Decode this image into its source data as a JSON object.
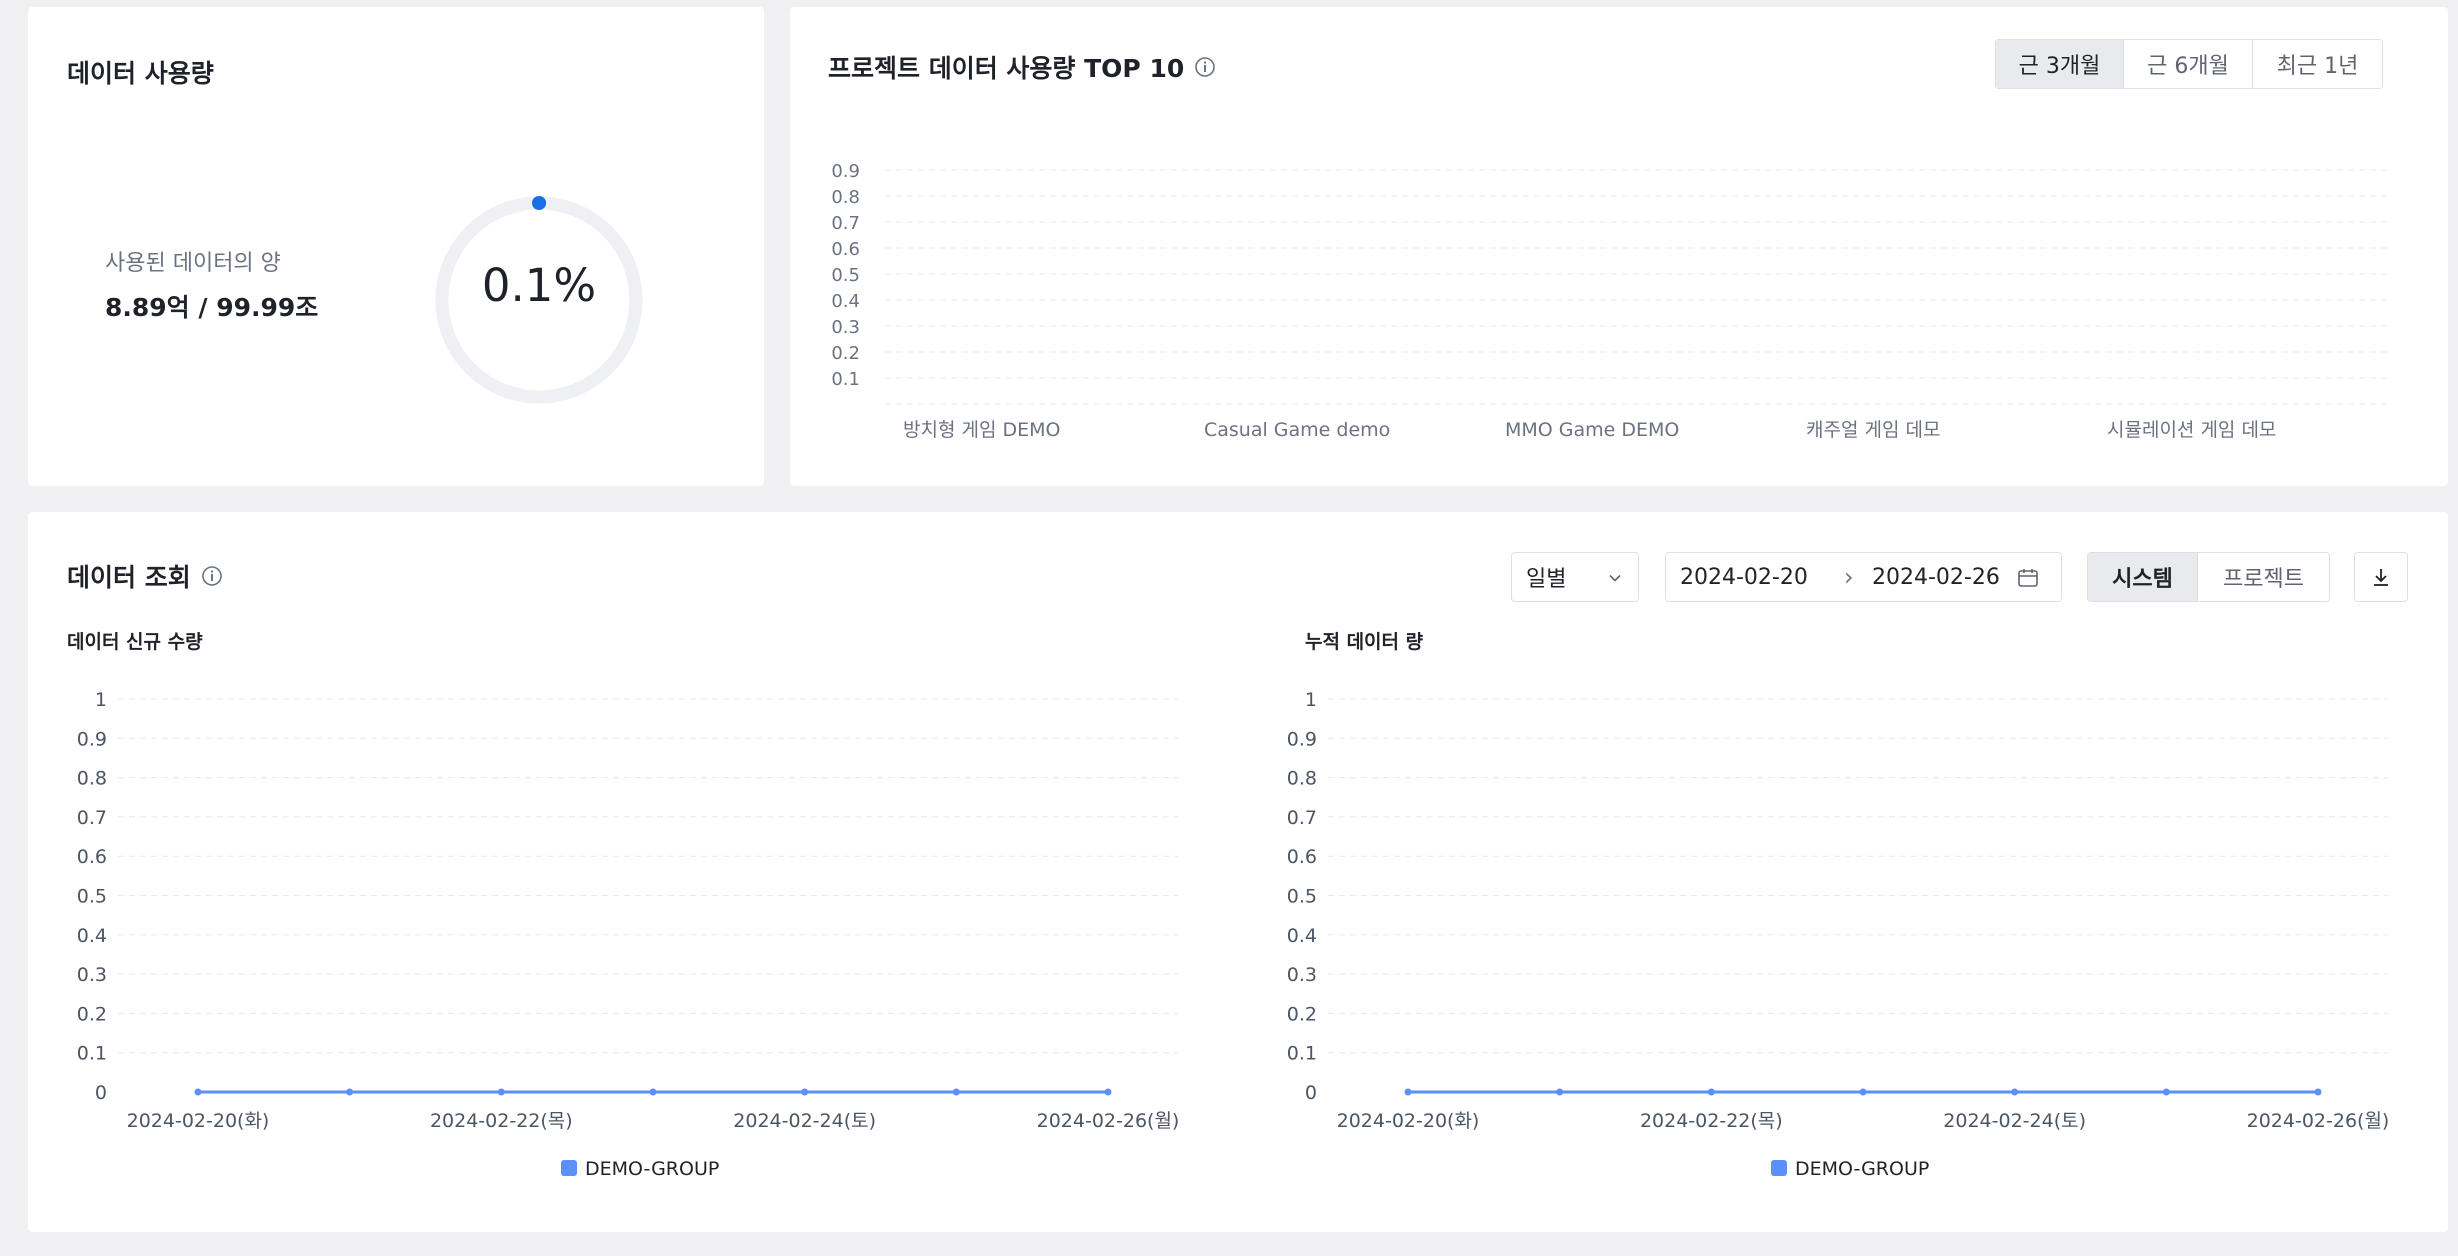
{
  "usage_card": {
    "title": "데이터 사용량",
    "used_label": "사용된 데이터의 양",
    "used_value": "8.89억 / 99.99조",
    "percent_text": "0.1%",
    "percent_value": 0.1,
    "accent_color": "#1a6fe8"
  },
  "top10_card": {
    "title": "프로젝트 데이터 사용량 TOP 10",
    "info_icon": "info-circle-icon",
    "ranges": [
      "근 3개월",
      "근 6개월",
      "최근 1년"
    ],
    "active_range": 0
  },
  "query_card": {
    "title": "데이터 조회",
    "info_icon": "info-circle-icon",
    "interval": "일별",
    "date_start": "2024-02-20",
    "date_end": "2024-02-26",
    "date_separator": "›",
    "view_modes": [
      "시스템",
      "프로젝트"
    ],
    "active_view": 0,
    "download_icon": "download-icon"
  },
  "chart_data": [
    {
      "type": "bar",
      "title": "프로젝트 데이터 사용량 TOP 10",
      "categories": [
        "방치형 게임 DEMO",
        "Casual Game demo",
        "MMO Game DEMO",
        "캐주얼 게임 데모",
        "시뮬레이션 게임 데모"
      ],
      "values": [
        0,
        0,
        0,
        0,
        0
      ],
      "yticks": [
        "0.1",
        "0.2",
        "0.3",
        "0.4",
        "0.5",
        "0.6",
        "0.7",
        "0.8",
        "0.9"
      ],
      "ylim": [
        0,
        1
      ],
      "grid": true
    },
    {
      "type": "line",
      "title": "데이터 신규 수량",
      "x": [
        "2024-02-20",
        "2024-02-21",
        "2024-02-22",
        "2024-02-23",
        "2024-02-24",
        "2024-02-25",
        "2024-02-26"
      ],
      "xticks": [
        "2024-02-20(화)",
        "2024-02-22(목)",
        "2024-02-24(토)",
        "2024-02-26(월)"
      ],
      "yticks": [
        "0",
        "0.1",
        "0.2",
        "0.3",
        "0.4",
        "0.5",
        "0.6",
        "0.7",
        "0.8",
        "0.9",
        "1"
      ],
      "ylim": [
        0,
        1
      ],
      "series": [
        {
          "name": "DEMO-GROUP",
          "values": [
            0,
            0,
            0,
            0,
            0,
            0,
            0
          ],
          "color": "#5b8ff9"
        }
      ],
      "legend": "bottom",
      "grid": true
    },
    {
      "type": "line",
      "title": "누적 데이터 량",
      "x": [
        "2024-02-20",
        "2024-02-21",
        "2024-02-22",
        "2024-02-23",
        "2024-02-24",
        "2024-02-25",
        "2024-02-26"
      ],
      "xticks": [
        "2024-02-20(화)",
        "2024-02-22(목)",
        "2024-02-24(토)",
        "2024-02-26(월)"
      ],
      "yticks": [
        "0",
        "0.1",
        "0.2",
        "0.3",
        "0.4",
        "0.5",
        "0.6",
        "0.7",
        "0.8",
        "0.9",
        "1"
      ],
      "ylim": [
        0,
        1
      ],
      "series": [
        {
          "name": "DEMO-GROUP",
          "values": [
            0,
            0,
            0,
            0,
            0,
            0,
            0
          ],
          "color": "#5b8ff9"
        }
      ],
      "legend": "bottom",
      "grid": true
    }
  ]
}
